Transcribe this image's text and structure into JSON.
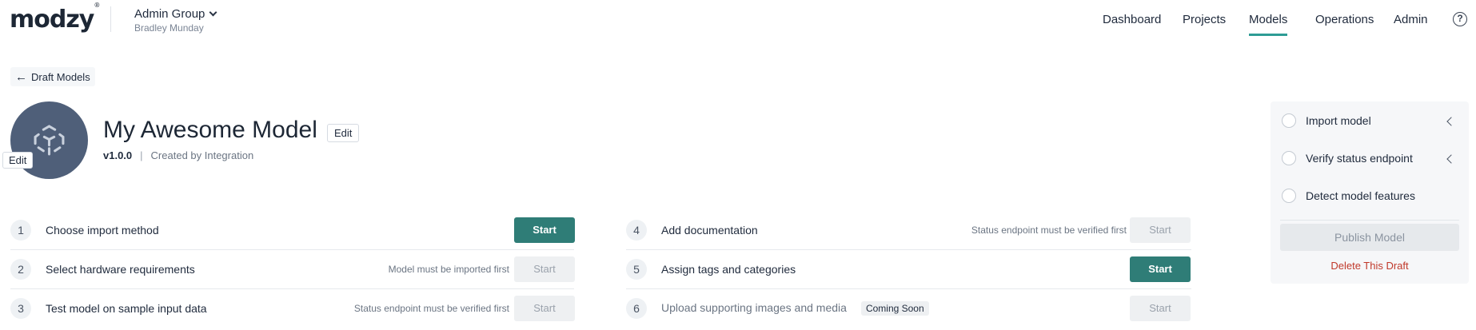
{
  "header": {
    "logo": "modzy",
    "logo_mark": "®",
    "group_name": "Admin Group",
    "user_name": "Bradley Munday",
    "nav": [
      {
        "label": "Dashboard"
      },
      {
        "label": "Projects"
      },
      {
        "label": "Models"
      },
      {
        "label": "Operations"
      },
      {
        "label": "Admin"
      }
    ],
    "active_nav": "Models",
    "help_glyph": "?"
  },
  "back_link": {
    "label": "Draft Models"
  },
  "model": {
    "title": "My Awesome Model",
    "title_edit_label": "Edit",
    "avatar_edit_label": "Edit",
    "version": "v1.0.0",
    "separator": "|",
    "created_by": "Created by Integration"
  },
  "steps": [
    {
      "num": "1",
      "label": "Choose import method",
      "note": "",
      "button": "Start",
      "enabled": true
    },
    {
      "num": "2",
      "label": "Select hardware requirements",
      "note": "Model must be imported first",
      "button": "Start",
      "enabled": false
    },
    {
      "num": "3",
      "label": "Test model on sample input data",
      "note": "Status endpoint must be verified first",
      "button": "Start",
      "enabled": false
    },
    {
      "num": "4",
      "label": "Add documentation",
      "note": "Status endpoint must be verified first",
      "button": "Start",
      "enabled": false
    },
    {
      "num": "5",
      "label": "Assign tags and categories",
      "note": "",
      "button": "Start",
      "enabled": true
    },
    {
      "num": "6",
      "label": "Upload supporting images and media",
      "note": "",
      "badge": "Coming Soon",
      "button": "Start",
      "enabled": false
    }
  ],
  "checklist": [
    {
      "label": "Import model"
    },
    {
      "label": "Verify status endpoint"
    },
    {
      "label": "Detect model features"
    }
  ],
  "publish_label": "Publish Model",
  "delete_label": "Delete This Draft",
  "colors": {
    "accent": "#2e9c95",
    "primary_button": "#2f7d77",
    "avatar": "#4f5f79",
    "danger": "#c0392b"
  }
}
